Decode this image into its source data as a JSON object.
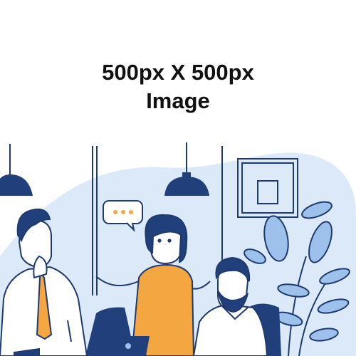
{
  "placeholder": {
    "line1": "500px X 500px",
    "line2": "Image"
  },
  "colors": {
    "ink": "#1e3a6e",
    "blob": "#dce9f9",
    "leaf": "#9ec1ec",
    "orange": "#f4a640",
    "lamp": "#213f7a",
    "skin": "#ffffff"
  },
  "illustration": {
    "subject": "office-team-discussion",
    "speech_bubble_dots": 3
  }
}
